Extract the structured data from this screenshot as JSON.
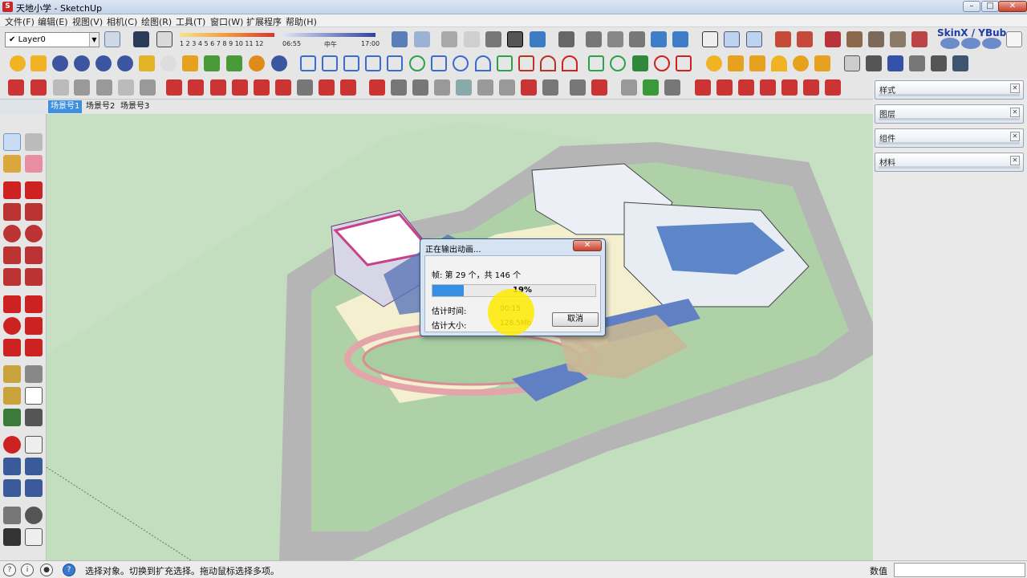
{
  "window": {
    "title": "天地小学 - SketchUp",
    "min": "–",
    "max": "□",
    "close": "✕"
  },
  "menu": [
    "文件(F)",
    "编辑(E)",
    "视图(V)",
    "相机(C)",
    "绘图(R)",
    "工具(T)",
    "窗口(W)",
    "扩展程序",
    "帮助(H)"
  ],
  "toolbar": {
    "layer": {
      "check": "✔",
      "name": "Layer0"
    },
    "shadow_months": "1 2 3 4 5 6 7 8 9 10 11 12",
    "shadow_time_start": "06:55",
    "shadow_time_mid": "中午",
    "shadow_time_end": "17:00",
    "plugin_label": "SkinX / YBub"
  },
  "scenes": [
    "场景号1",
    "场景号2",
    "场景号3"
  ],
  "tray": [
    "样式",
    "图层",
    "组件",
    "材料"
  ],
  "dialog": {
    "title": "正在输出动画...",
    "frames": "帧: 第 29 个，共 146 个",
    "progress_percent": 19,
    "progress_label": "19%",
    "time_label": "估计时间:",
    "time_value": "00:15",
    "size_label": "估计大小:",
    "size_value": "128.5Mb",
    "cancel": "取消"
  },
  "status": {
    "message": "选择对象。切换到扩充选择。拖动鼠标选择多项。",
    "measure_label": "数值",
    "measure_value": ""
  },
  "colors": {
    "selection_blue": "#3590e3",
    "ground_green": "#c7dfc3",
    "road_gray": "#b4b4b4",
    "halo_yellow": "#ffeb00"
  }
}
